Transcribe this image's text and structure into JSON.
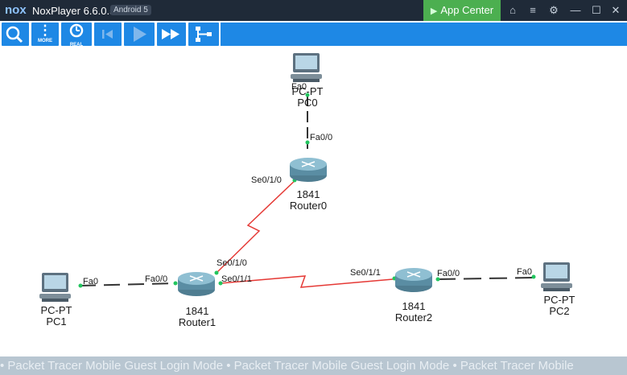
{
  "titlebar": {
    "logo": "nox",
    "title": "NoxPlayer 6.6.0.5",
    "android_badge": "Android 5",
    "app_center": "App Center"
  },
  "toolbar": {
    "more": "MORE",
    "real": "REAL"
  },
  "devices": {
    "pc0": {
      "model": "PC-PT",
      "name": "PC0",
      "port": "Fa0"
    },
    "pc1": {
      "model": "PC-PT",
      "name": "PC1",
      "port": "Fa0"
    },
    "pc2": {
      "model": "PC-PT",
      "name": "PC2",
      "port": "Fa0"
    },
    "router0": {
      "model": "1841",
      "name": "Router0",
      "ports": [
        "Fa0/0",
        "Se0/1/0"
      ]
    },
    "router1": {
      "model": "1841",
      "name": "Router1",
      "ports": [
        "Fa0/0",
        "Se0/1/0",
        "Se0/1/1"
      ]
    },
    "router2": {
      "model": "1841",
      "name": "Router2",
      "ports": [
        "Se0/1/1",
        "Fa0/0"
      ]
    }
  },
  "footer": "• Packet Tracer Mobile Guest Login Mode • Packet Tracer Mobile Guest Login Mode • Packet Tracer Mobile",
  "colors": {
    "serial_link": "#e53935",
    "ethernet_link": "#333333",
    "toolbar": "#1e88e5",
    "titlebar": "#1f2a38",
    "app_center": "#4caf50"
  }
}
